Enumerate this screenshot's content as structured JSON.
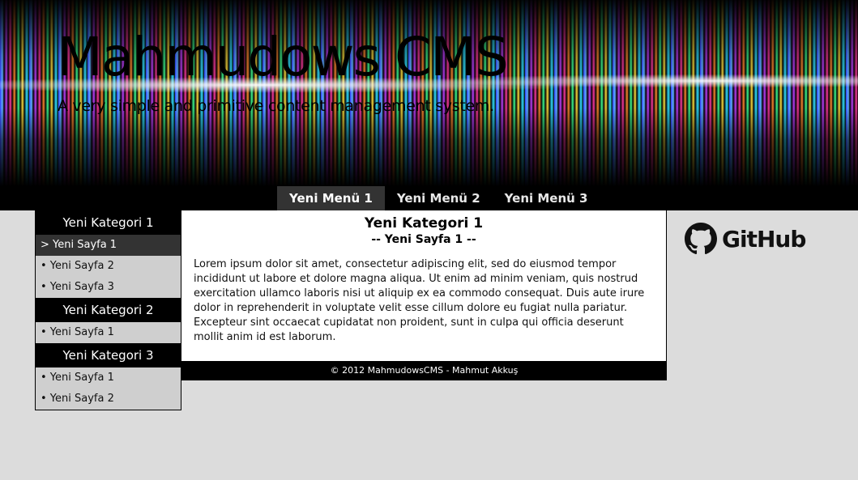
{
  "header": {
    "title": "Mahmudows CMS",
    "subtitle": "A very simple and primitive content management system."
  },
  "nav": {
    "items": [
      {
        "label": "Yeni Menü 1",
        "active": true
      },
      {
        "label": "Yeni Menü 2",
        "active": false
      },
      {
        "label": "Yeni Menü 3",
        "active": false
      }
    ]
  },
  "sidebar": {
    "categories": [
      {
        "title": "Yeni Kategori 1",
        "pages": [
          "> Yeni Sayfa 1",
          "• Yeni Sayfa 2",
          "• Yeni Sayfa 3"
        ]
      },
      {
        "title": "Yeni Kategori 2",
        "pages": [
          "• Yeni Sayfa 1"
        ]
      },
      {
        "title": "Yeni Kategori 3",
        "pages": [
          "• Yeni Sayfa 1",
          "• Yeni Sayfa 2"
        ]
      }
    ]
  },
  "content": {
    "category": "Yeni Kategori 1",
    "page": "-- Yeni Sayfa 1 --",
    "body": "Lorem ipsum dolor sit amet, consectetur adipiscing elit, sed do eiusmod tempor incididunt ut labore et dolore magna aliqua. Ut enim ad minim veniam, quis nostrud exercitation ullamco laboris nisi ut aliquip ex ea commodo consequat. Duis aute irure dolor in reprehenderit in voluptate velit esse cillum dolore eu fugiat nulla pariatur. Excepteur sint occaecat cupidatat non proident, sunt in culpa qui officia deserunt mollit anim id est laborum."
  },
  "footer": {
    "text": "© 2012 MahmudowsCMS - Mahmut Akkuş"
  },
  "github": {
    "label": "GitHub",
    "icon": "github-octocat-icon"
  },
  "colors": {
    "page_bg": "#dcdcdc",
    "bar_bg": "#000000",
    "active_bg": "#333333"
  }
}
